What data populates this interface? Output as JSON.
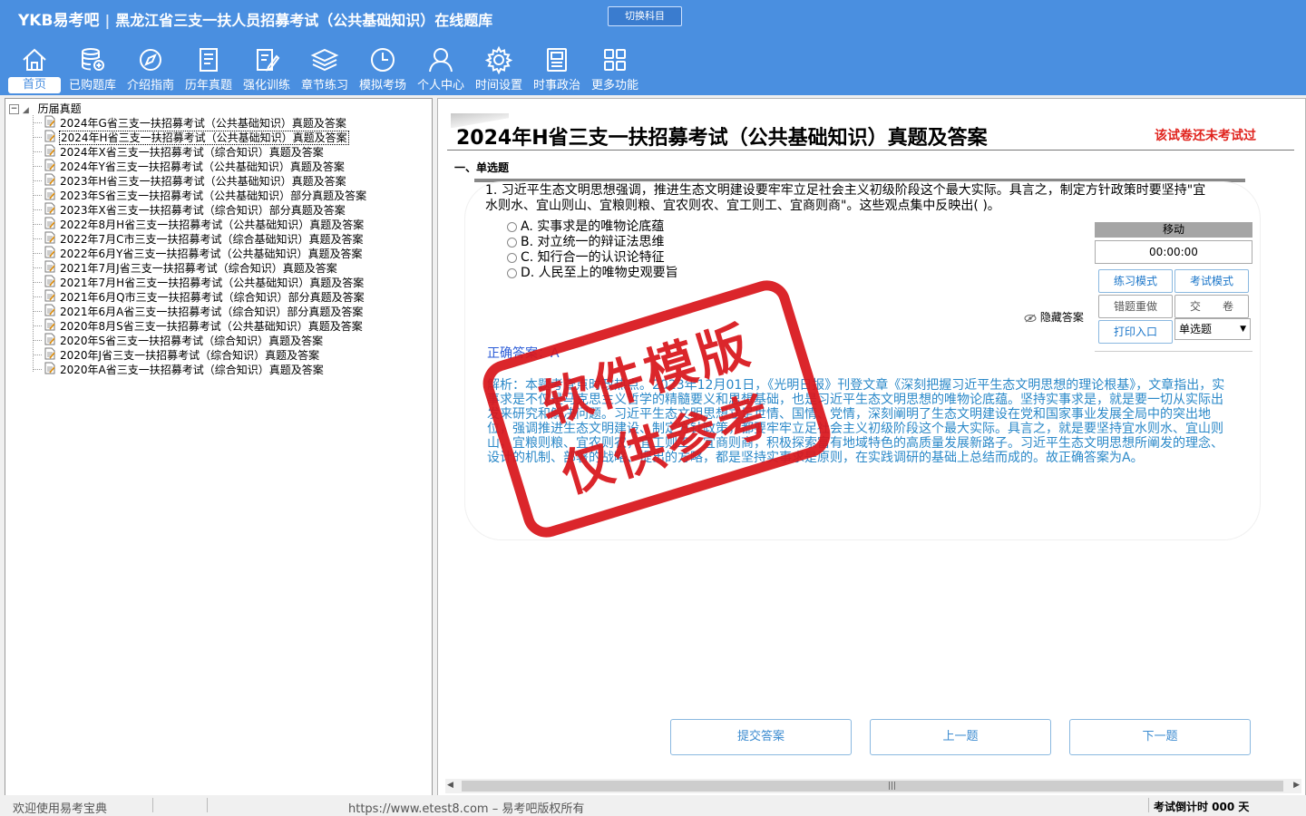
{
  "header": {
    "brand": "YKB易考吧",
    "title": "黑龙江省三支一扶人员招募考试（公共基础知识）在线题库",
    "switch_label": "切换科目"
  },
  "nav": [
    {
      "label": "首页",
      "icon": "home-icon",
      "active": true
    },
    {
      "label": "已购题库",
      "icon": "database-icon"
    },
    {
      "label": "介绍指南",
      "icon": "compass-icon"
    },
    {
      "label": "历年真题",
      "icon": "document-list-icon"
    },
    {
      "label": "强化训练",
      "icon": "edit-icon"
    },
    {
      "label": "章节练习",
      "icon": "layers-icon"
    },
    {
      "label": "模拟考场",
      "icon": "clock-icon"
    },
    {
      "label": "个人中心",
      "icon": "user-icon"
    },
    {
      "label": "时间设置",
      "icon": "gear-icon"
    },
    {
      "label": "时事政治",
      "icon": "news-icon"
    },
    {
      "label": "更多功能",
      "icon": "grid-icon"
    }
  ],
  "tree": {
    "root": "历届真题",
    "items": [
      "2024年G省三支一扶招募考试（公共基础知识）真题及答案",
      "2024年H省三支一扶招募考试（公共基础知识）真题及答案",
      "2024年X省三支一扶招募考试（综合知识）真题及答案",
      "2024年Y省三支一扶招募考试（公共基础知识）真题及答案",
      "2023年H省三支一扶招募考试（公共基础知识）真题及答案",
      "2023年S省三支一扶招募考试（公共基础知识）部分真题及答案",
      "2023年X省三支一扶招募考试（综合知识）部分真题及答案",
      "2022年8月H省三支一扶招募考试（公共基础知识）真题及答案",
      "2022年7月C市三支一扶招募考试（综合基础知识）真题及答案",
      "2022年6月Y省三支一扶招募考试（公共基础知识）真题及答案",
      "2021年7月J省三支一扶招募考试（综合知识）真题及答案",
      "2021年7月H省三支一扶招募考试（公共基础知识）真题及答案",
      "2021年6月Q市三支一扶招募考试（综合知识）部分真题及答案",
      "2021年6月A省三支一扶招募考试（综合知识）部分真题及答案",
      "2020年8月S省三支一扶招募考试（公共基础知识）真题及答案",
      "2020年S省三支一扶招募考试（综合知识）真题及答案",
      "2020年J省三支一扶招募考试（综合知识）真题及答案",
      "2020年A省三支一扶招募考试（综合知识）真题及答案"
    ],
    "selected_index": 1
  },
  "exam": {
    "title": "2024年H省三支一扶招募考试（公共基础知识）真题及答案",
    "status": "该试卷还未考试过",
    "section": "一、单选题",
    "question": "1. 习近平生态文明思想强调，推进生态文明建设要牢牢立足社会主义初级阶段这个最大实际。具言之，制定方针政策时要坚持\"宜水则水、宜山则山、宜粮则粮、宜农则农、宜工则工、宜商则商\"。这些观点集中反映出( )。",
    "options": [
      "A. 实事求是的唯物论底蕴",
      "B. 对立统一的辩证法思维",
      "C. 知行合一的认识论特征",
      "D. 人民至上的唯物史观要旨"
    ],
    "answer_label": "正确答案：",
    "answer": "A",
    "analysis": "解析：本题考查点时政热点。2023年12月01日，《光明日报》刊登文章《深刻把握习近平生态文明思想的理论根基》，文章指出，实事求是不仅是马克思主义哲学的精髓要义和思想基础，也是习近平生态文明思想的唯物论底蕴。坚持实事求是，就是要一切从实际出发来研究和解决问题。习近平生态文明思想立足世情、国情、党情，深刻阐明了生态文明建设在党和国家事业发展全局中的突出地位，强调推进生态文明建设、制定方针政策，都要牢牢立足社会主义初级阶段这个最大实际。具言之，就是要坚持宜水则水、宜山则山，宜粮则粮、宜农则农，宜工则工、宜商则商，积极探索富有地域特色的高质量发展新路子。习近平生态文明思想所阐发的理念、设计的机制、部署的战略、提出的方略，都是坚持实事求是原则，在实践调研的基础上总结而成的。故正确答案为A。",
    "hide_answer": "隐藏答案"
  },
  "tools": {
    "move": "移动",
    "timer": "00:00:00",
    "practice_mode": "练习模式",
    "exam_mode": "考试模式",
    "redo_wrong": "错题重做",
    "submit_paper": "交　　卷",
    "print_entry": "打印入口",
    "question_type": "单选题"
  },
  "buttons": {
    "submit": "提交答案",
    "prev": "上一题",
    "next": "下一题"
  },
  "stamp": {
    "line1": "软件模版",
    "line2": "仅供参考"
  },
  "statusbar": {
    "welcome": "欢迎使用易考宝典",
    "url": "https://www.etest8.com – 易考吧版权所有",
    "countdown": "考试倒计时 000 天"
  },
  "colors": {
    "header_bg": "#4a8fe0",
    "status_red": "#e0231d",
    "answer_blue": "#2a5bd7",
    "analysis_blue": "#2a88c8",
    "stamp_red": "#d9161c"
  }
}
